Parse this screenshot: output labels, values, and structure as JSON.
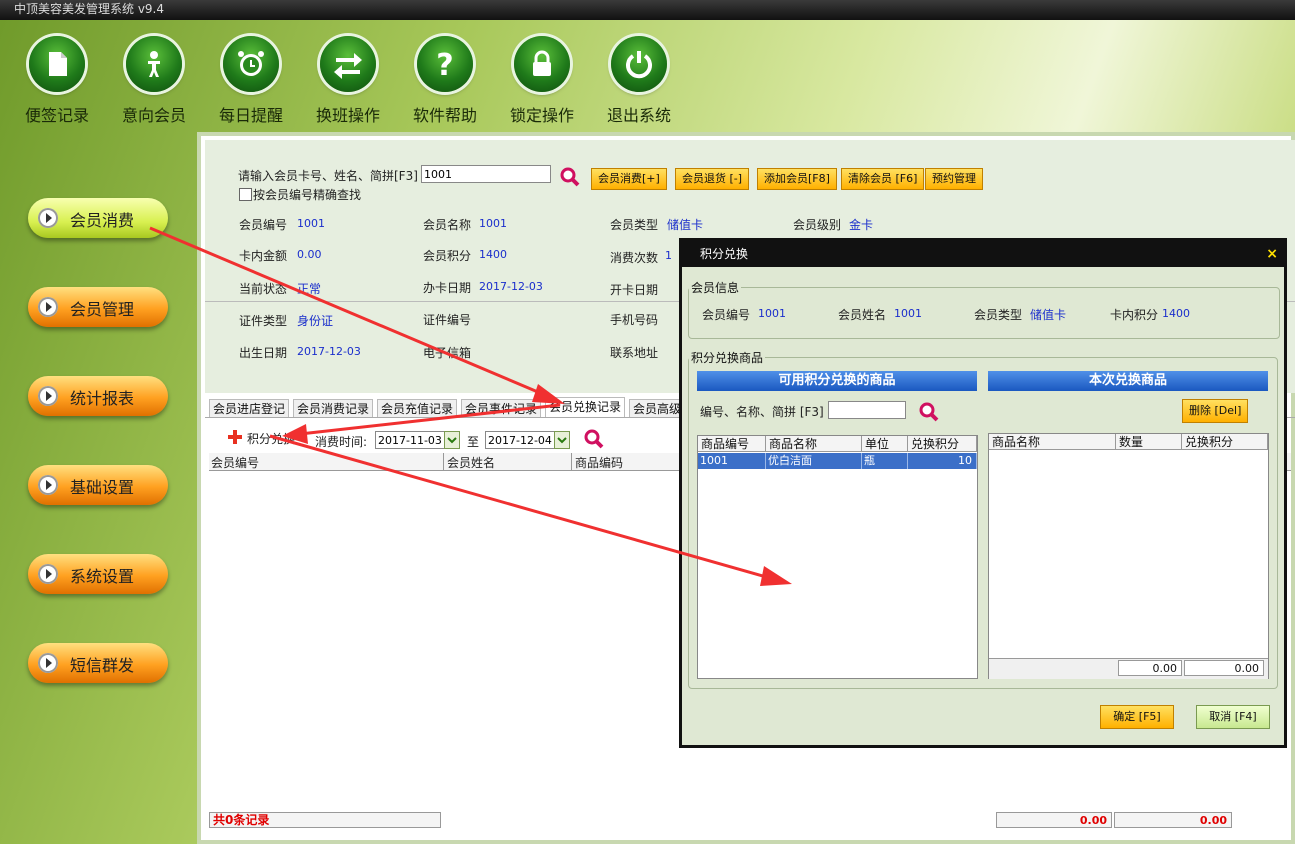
{
  "app": {
    "title": "中顶美容美发管理系统 v9.4"
  },
  "topnav": [
    {
      "label": "便签记录",
      "icon": "note-icon"
    },
    {
      "label": "意向会员",
      "icon": "person-icon"
    },
    {
      "label": "每日提醒",
      "icon": "alarm-clock-icon"
    },
    {
      "label": "换班操作",
      "icon": "swap-arrows-icon"
    },
    {
      "label": "软件帮助",
      "icon": "help-icon"
    },
    {
      "label": "锁定操作",
      "icon": "lock-icon"
    },
    {
      "label": "退出系统",
      "icon": "power-icon"
    }
  ],
  "sidebar": [
    {
      "label": "会员消费",
      "active": true
    },
    {
      "label": "会员管理"
    },
    {
      "label": "统计报表"
    },
    {
      "label": "基础设置"
    },
    {
      "label": "系统设置"
    },
    {
      "label": "短信群发"
    }
  ],
  "search": {
    "prompt": "请输入会员卡号、姓名、简拼[F3]",
    "value": "1001",
    "exact_label": "按会员编号精确查找",
    "buttons": [
      "会员消费[+]",
      "会员退货 [-]",
      "添加会员[F8]",
      "清除会员 [F6]",
      "预约管理"
    ]
  },
  "member": {
    "id_label": "会员编号",
    "id": "1001",
    "name_label": "会员名称",
    "name": "1001",
    "type_label": "会员类型",
    "type": "储值卡",
    "level_label": "会员级别",
    "level": "金卡",
    "balance_label": "卡内金额",
    "balance": "0.00",
    "points_label": "会员积分",
    "points": "1400",
    "visits_label": "消费次数",
    "visits": "1",
    "status_label": "当前状态",
    "status": "正常",
    "issue_label": "办卡日期",
    "issue": "2017-12-03",
    "open_label": "开卡日期",
    "idtype_label": "证件类型",
    "idtype": "身份证",
    "idno_label": "证件编号",
    "phone_label": "手机号码",
    "birth_label": "出生日期",
    "birth": "2017-12-03",
    "email_label": "电子信箱",
    "addr_label": "联系地址"
  },
  "tabs": [
    "会员进店登记",
    "会员消费记录",
    "会员充值记录",
    "会员事件记录",
    "会员兑换记录",
    "会员高级"
  ],
  "records": {
    "add_label": "积分兑换",
    "time_label": "消费时间:",
    "from": "2017-11-03",
    "to_label": "至",
    "to": "2017-12-04",
    "columns": [
      "会员编号",
      "会员姓名",
      "商品编码"
    ],
    "count": "共0条记录",
    "sum1": "0.00",
    "sum2": "0.00"
  },
  "dialog": {
    "title": "积分兑换",
    "info_legend": "会员信息",
    "m_id_label": "会员编号",
    "m_id": "1001",
    "m_name_label": "会员姓名",
    "m_name": "1001",
    "m_type_label": "会员类型",
    "m_type": "储值卡",
    "m_points_label": "卡内积分",
    "m_points": "1400",
    "goods_legend": "积分兑换商品",
    "avail_header": "可用积分兑换的商品",
    "this_header": "本次兑换商品",
    "filter_label": "编号、名称、简拼 [F3]",
    "filter_value": "",
    "delete_btn": "删除 [Del]",
    "left_cols": [
      "商品编号",
      "商品名称",
      "单位",
      "兑换积分"
    ],
    "left_rows": [
      [
        "1001",
        "优白洁面",
        "瓶",
        "10"
      ]
    ],
    "right_cols": [
      "商品名称",
      "数量",
      "兑换积分"
    ],
    "right_foot": [
      "0.00",
      "0.00"
    ],
    "ok": "确定 [F5]",
    "cancel": "取消 [F4]"
  },
  "colors": {
    "accent_blue": "#1a58c0",
    "button_orange": "#ffb000",
    "arrow_red": "#f03030"
  }
}
